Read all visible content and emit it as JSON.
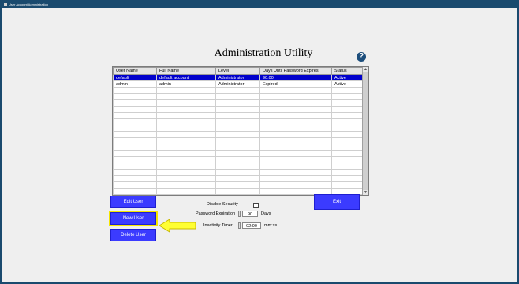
{
  "window": {
    "title": "User Account Administration"
  },
  "heading": "Administration Utility",
  "help_glyph": "?",
  "table": {
    "columns": [
      "User Name",
      "Full Name",
      "Level",
      "Days Until Password Expires",
      "Status"
    ],
    "rows": [
      [
        "default",
        "default account",
        "Administrator",
        "90.00",
        "Active"
      ],
      [
        "admin",
        "admin",
        "Administrator",
        "Expired",
        "Active"
      ]
    ],
    "selected_row": 0,
    "scroll_up_glyph": "▲",
    "scroll_down_glyph": "▼"
  },
  "buttons": {
    "edit_user": "Edit User",
    "new_user": "New User",
    "delete_user": "Delete User",
    "exit": "Exit"
  },
  "settings": {
    "disable_security_label": "Disable Security",
    "disable_security_checked": false,
    "password_expiration_label": "Password Expiration",
    "password_expiration_value": "90",
    "password_expiration_unit": "Days",
    "inactivity_timer_label": "Inactivity Timer",
    "inactivity_timer_value": "02:00",
    "inactivity_timer_unit": "mm:ss"
  },
  "colors": {
    "accent": "#3b3bff",
    "selection": "#0000cc",
    "highlight": "#f5e500",
    "window_frame": "#1a4a6e"
  },
  "icons": {
    "help": "help-icon",
    "annotation": "arrow-left-icon"
  }
}
